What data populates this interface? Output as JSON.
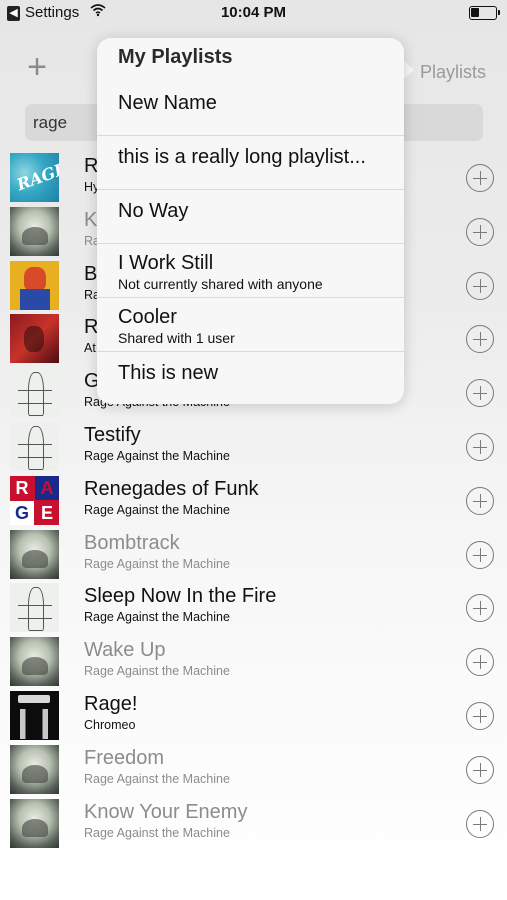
{
  "status_bar": {
    "back_glyph": "◀",
    "app_label": "Settings",
    "wifi_icon": "wifi-icon",
    "time": "10:04 PM",
    "battery_level": 0.35
  },
  "nav": {
    "add_glyph": "+",
    "playlists_label": "Playlists"
  },
  "search": {
    "value": "rage"
  },
  "songs": [
    {
      "title": "R",
      "artist": "Hy",
      "art": "water",
      "dim": false
    },
    {
      "title": "K",
      "artist": "Ra",
      "art": "monk",
      "dim": true
    },
    {
      "title": "B",
      "artist": "Ra",
      "art": "yellow",
      "dim": false
    },
    {
      "title": "R",
      "artist": "At",
      "art": "red",
      "dim": false
    },
    {
      "title": "G",
      "artist": "Rage Against the Machine",
      "art": "line",
      "dim": false
    },
    {
      "title": "Testify",
      "artist": "Rage Against the Machine",
      "art": "line",
      "dim": false
    },
    {
      "title": "Renegades of Funk",
      "artist": "Rage Against the Machine",
      "art": "rage",
      "dim": false
    },
    {
      "title": "Bombtrack",
      "artist": "Rage Against the Machine",
      "art": "monk",
      "dim": true
    },
    {
      "title": "Sleep Now In the Fire",
      "artist": "Rage Against the Machine",
      "art": "line",
      "dim": false
    },
    {
      "title": "Wake Up",
      "artist": "Rage Against the Machine",
      "art": "monk",
      "dim": true
    },
    {
      "title": "Rage!",
      "artist": "Chromeo",
      "art": "dark",
      "dim": false
    },
    {
      "title": "Freedom",
      "artist": "Rage Against the Machine",
      "art": "monk",
      "dim": true
    },
    {
      "title": "Know Your Enemy",
      "artist": "Rage Against the Machine",
      "art": "monk",
      "dim": true
    }
  ],
  "album_art_text": {
    "water": "RAGE",
    "rage": [
      "R",
      "A",
      "G",
      "E"
    ]
  },
  "popover": {
    "title": "My Playlists",
    "playlists": [
      {
        "name": "New Name",
        "subtitle": ""
      },
      {
        "name": "this is a really long playlist...",
        "subtitle": ""
      },
      {
        "name": "No Way",
        "subtitle": ""
      },
      {
        "name": "I Work Still",
        "subtitle": "Not currently shared with anyone"
      },
      {
        "name": "Cooler",
        "subtitle": "Shared with 1 user"
      },
      {
        "name": "This is new",
        "subtitle": ""
      }
    ]
  },
  "colors": {
    "dim_text": "#8c8c8c",
    "accent_gray": "#9a9a9a",
    "popover_bg": "#f7f7f7"
  }
}
